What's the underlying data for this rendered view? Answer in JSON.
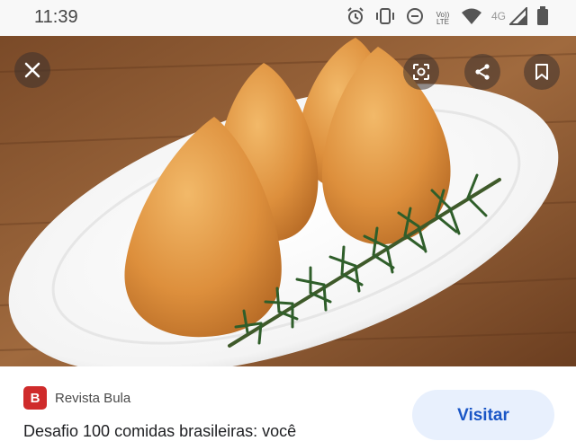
{
  "status_bar": {
    "time": "11:39",
    "icons": [
      "alarm-icon",
      "vibrate-icon",
      "do-not-disturb-icon",
      "volte-icon",
      "wifi-icon",
      "cellular-signal-icon",
      "battery-icon"
    ],
    "volte_top": "Vo))",
    "volte_bottom": "LTE",
    "network_type": "4G"
  },
  "image_viewer": {
    "overlay_buttons": [
      "lens-search-icon",
      "share-icon",
      "bookmark-icon"
    ],
    "close_icon": "close-icon"
  },
  "result": {
    "source_initial": "B",
    "source_name": "Revista Bula",
    "title": "Desafio 100 comidas brasileiras: você",
    "visit_label": "Visitar"
  },
  "colors": {
    "visit_bg": "#e8f0fd",
    "visit_text": "#1a56c6",
    "favicon": "#cf2b2b"
  }
}
